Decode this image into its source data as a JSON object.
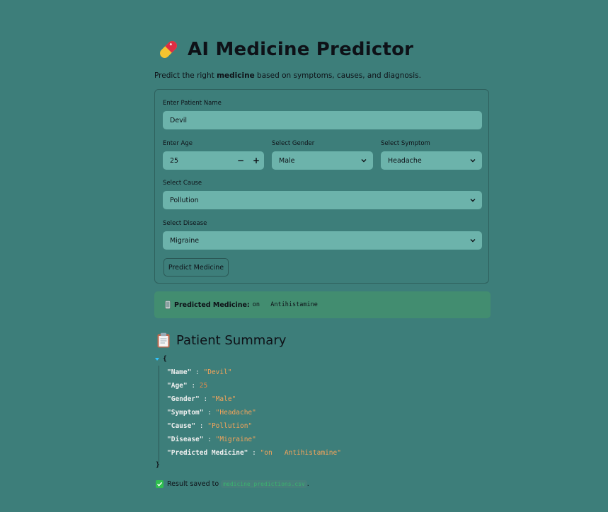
{
  "header": {
    "title": "AI Medicine Predictor",
    "subtitle_prefix": "Predict the right ",
    "subtitle_bold": "medicine",
    "subtitle_suffix": " based on symptoms, causes, and diagnosis.",
    "icon": "pill-icon"
  },
  "form": {
    "name_label": "Enter Patient Name",
    "name_value": "Devil",
    "age_label": "Enter Age",
    "age_value": "25",
    "gender_label": "Select Gender",
    "gender_value": "Male",
    "symptom_label": "Select Symptom",
    "symptom_value": "Headache",
    "cause_label": "Select Cause",
    "cause_value": "Pollution",
    "disease_label": "Select Disease",
    "disease_value": "Migraine",
    "submit_label": "Predict Medicine"
  },
  "result": {
    "label": "Predicted Medicine:",
    "value": "on   Antihistamine",
    "icon": "phone-icon",
    "color": "#428d70"
  },
  "summary": {
    "title": "Patient Summary",
    "icon": "clipboard-icon",
    "open_brace": "{",
    "close_brace": "}",
    "entries": [
      {
        "key": "\"Name\"",
        "value": "\"Devil\""
      },
      {
        "key": "\"Age\"",
        "value": "25"
      },
      {
        "key": "\"Gender\"",
        "value": "\"Male\""
      },
      {
        "key": "\"Symptom\"",
        "value": "\"Headache\""
      },
      {
        "key": "\"Cause\"",
        "value": "\"Pollution\""
      },
      {
        "key": "\"Disease\"",
        "value": "\"Migraine\""
      },
      {
        "key": "\"Predicted Medicine\"",
        "value": "\"on   Antihistamine\""
      }
    ]
  },
  "footer": {
    "saved_text": "Result saved to",
    "filename": "medicine_predictions.csv",
    "period": "."
  },
  "colors": {
    "background": "#3d7e7a",
    "field": "#6cb3ab",
    "success": "#2fbf4f"
  }
}
